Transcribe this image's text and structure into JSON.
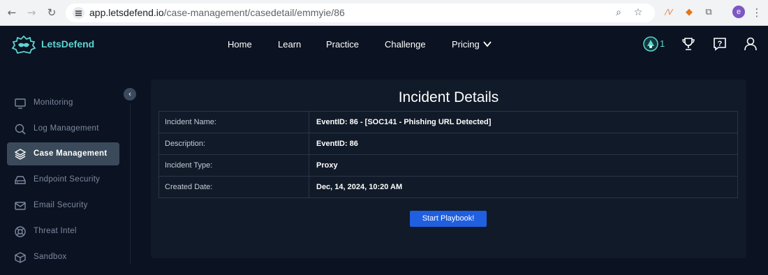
{
  "browser": {
    "url_host": "app.letsdefend.io",
    "url_path": "/case-management/casedetail/emmyie/86",
    "profile_initial": "e"
  },
  "brand": {
    "name": "LetsDefend",
    "accent": "#5fd3d2"
  },
  "nav": {
    "items": [
      "Home",
      "Learn",
      "Practice",
      "Challenge",
      "Pricing"
    ],
    "badge_count": "1"
  },
  "sidebar": {
    "items": [
      {
        "label": "Monitoring",
        "icon": "monitor-icon",
        "active": false
      },
      {
        "label": "Log Management",
        "icon": "search-icon",
        "active": false
      },
      {
        "label": "Case Management",
        "icon": "layers-icon",
        "active": true
      },
      {
        "label": "Endpoint Security",
        "icon": "hard-drive-icon",
        "active": false
      },
      {
        "label": "Email Security",
        "icon": "mail-icon",
        "active": false
      },
      {
        "label": "Threat Intel",
        "icon": "lifebuoy-icon",
        "active": false
      },
      {
        "label": "Sandbox",
        "icon": "box-icon",
        "active": false
      }
    ]
  },
  "incident": {
    "title": "Incident Details",
    "rows": [
      {
        "label": "Incident Name:",
        "value": "EventID: 86 - [SOC141 - Phishing URL Detected]"
      },
      {
        "label": "Description:",
        "value": "EventID: 86"
      },
      {
        "label": "Incident Type:",
        "value": "Proxy"
      },
      {
        "label": "Created Date:",
        "value": "Dec, 14, 2024, 10:20 AM"
      }
    ],
    "button_label": "Start Playbook!"
  },
  "colors": {
    "page_bg": "#0b1221",
    "panel_bg": "#111a28",
    "button": "#1f5fe0"
  }
}
